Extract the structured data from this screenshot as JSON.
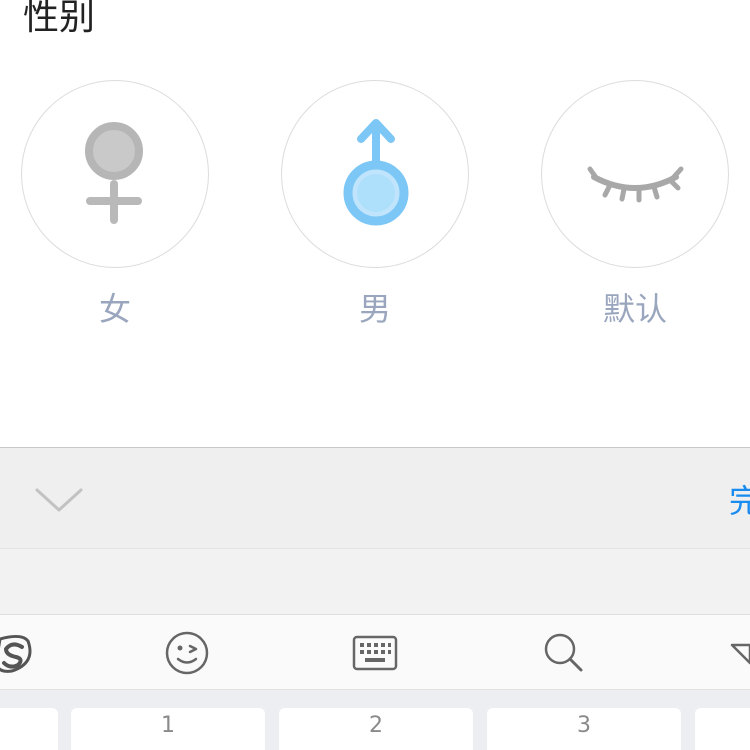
{
  "section": {
    "title": "性别"
  },
  "options": {
    "female": {
      "label": "女",
      "icon": "female-symbol-icon",
      "color": "#b9b9b9"
    },
    "male": {
      "label": "男",
      "icon": "male-symbol-icon",
      "color": "#7cc7f6",
      "selected": true
    },
    "default": {
      "label": "默认",
      "icon": "closed-eye-icon",
      "color": "#a8a8a8"
    }
  },
  "toolbar": {
    "collapse_icon": "chevron-down-icon",
    "done_label": "完"
  },
  "ime_toolbar": {
    "icons": [
      "sogou-logo-icon",
      "emoji-wink-icon",
      "keyboard-icon",
      "search-icon",
      "triangle-down-icon"
    ]
  },
  "keyboard": {
    "keys": [
      "1",
      "2",
      "3"
    ]
  },
  "colors": {
    "accent": "#1a8cf0",
    "label_gray": "#9aa6bd"
  }
}
